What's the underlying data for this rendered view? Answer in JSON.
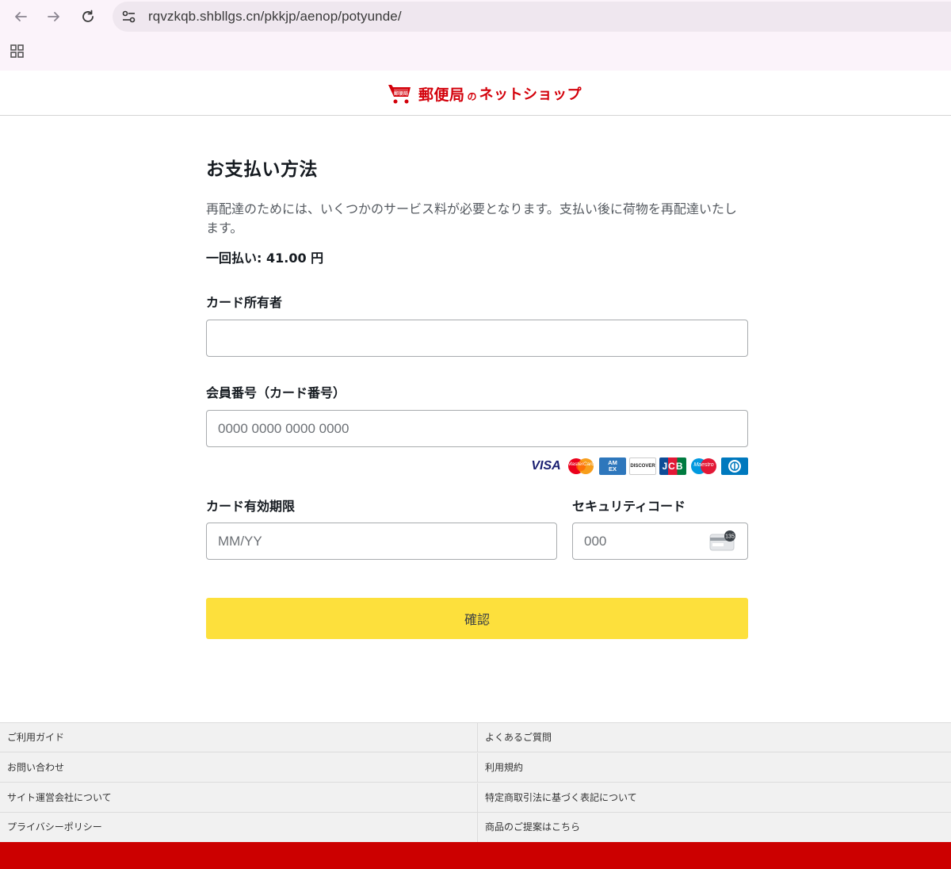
{
  "browser": {
    "url": "rqvzkqb.shbllgs.cn/pkkjp/aenop/potyunde/"
  },
  "header": {
    "logo_main": "郵便局",
    "logo_small": "の",
    "logo_sub": "ネットショップ",
    "logo_icon_text": "郵便局",
    "brand_color": "#d3000a"
  },
  "form": {
    "title": "お支払い方法",
    "description": "再配達のためには、いくつかのサービス料が必要となります。支払い後に荷物を再配達いたします。",
    "amount": "一回払い: 41.00 円",
    "holder_label": "カード所有者",
    "holder_value": "",
    "number_label": "会員番号（カード番号）",
    "number_placeholder": "0000 0000 0000 0000",
    "expiry_label": "カード有効期限",
    "expiry_placeholder": "MM/YY",
    "cvc_label": "セキュリティコード",
    "cvc_placeholder": "000",
    "cvc_icon_text": "135",
    "confirm_label": "確認",
    "confirm_color": "#fde03c",
    "card_brands": [
      {
        "name": "visa-icon",
        "text": "VISA"
      },
      {
        "name": "mastercard-icon",
        "text": "MasterCard"
      },
      {
        "name": "amex-icon",
        "text": "AM EX"
      },
      {
        "name": "discover-icon",
        "text": "DISCOVER"
      },
      {
        "name": "jcb-icon",
        "text": "JCB"
      },
      {
        "name": "maestro-icon",
        "text": "Maestro"
      },
      {
        "name": "diners-icon",
        "text": ""
      }
    ]
  },
  "footer": {
    "left": [
      "ご利用ガイド",
      "お問い合わせ",
      "サイト運営会社について",
      "プライバシーポリシー"
    ],
    "right": [
      "よくあるご質問",
      "利用規約",
      "特定商取引法に基づく表記について",
      "商品のご提案はこちら"
    ],
    "bar_color": "#cc0000"
  }
}
